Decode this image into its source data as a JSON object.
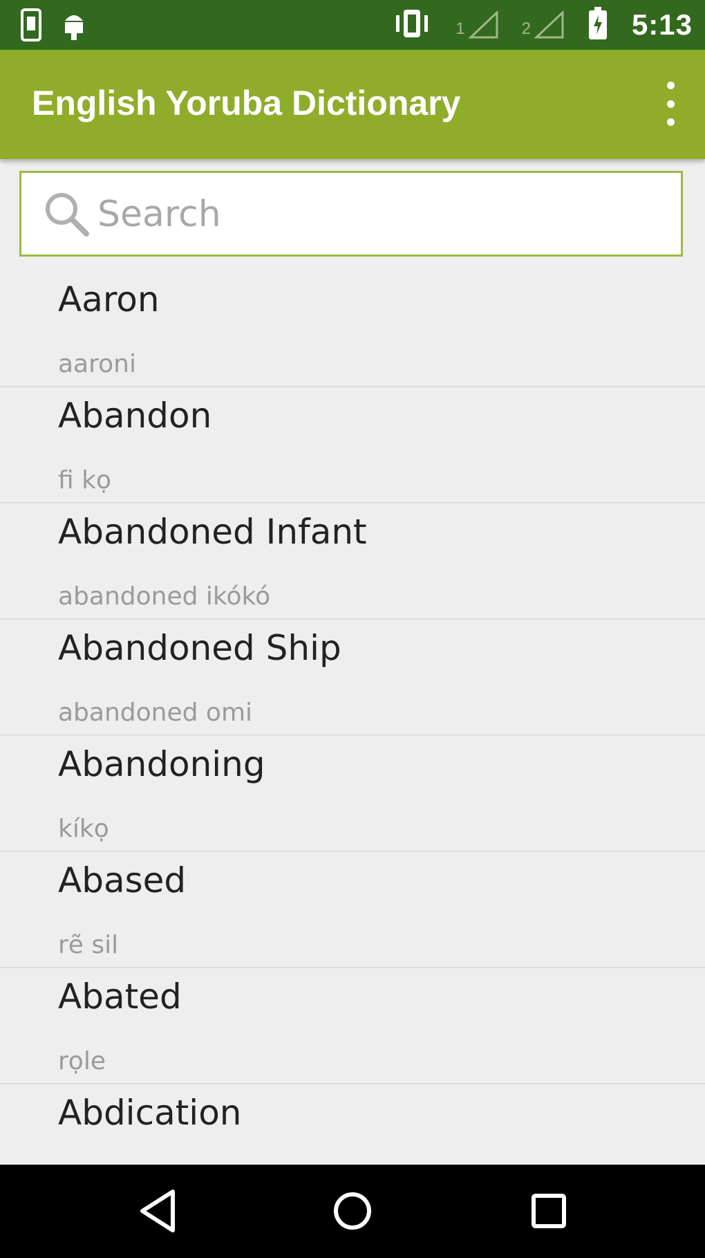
{
  "status_bar": {
    "left_icons": [
      "phone-icon",
      "android-debug-icon"
    ],
    "right_icons": [
      "vibrate-icon",
      "signal-1-icon",
      "signal-2-icon",
      "battery-icon"
    ],
    "sim1_label": "1",
    "sim2_label": "2",
    "time": "5:13"
  },
  "app_bar": {
    "title": "English Yoruba Dictionary",
    "menu_icon": "more-vert-icon"
  },
  "search": {
    "placeholder": "Search",
    "value": "",
    "icon": "search-icon"
  },
  "entries": [
    {
      "word": "Aaron",
      "translation": "aaroni"
    },
    {
      "word": "Abandon",
      "translation": "fi kọ"
    },
    {
      "word": "Abandoned Infant",
      "translation": "abandoned ikókó"
    },
    {
      "word": "Abandoned Ship",
      "translation": "abandoned omi"
    },
    {
      "word": "Abandoning",
      "translation": "kíkọ"
    },
    {
      "word": "Abased",
      "translation": "rẽ sil"
    },
    {
      "word": "Abated",
      "translation": "rọle"
    },
    {
      "word": "Abdication",
      "translation": ""
    }
  ],
  "nav_bar": {
    "icons": [
      "back-icon",
      "home-icon",
      "recents-icon"
    ]
  },
  "colors": {
    "status_bar": "#33691e",
    "app_bar": "#8fad2b",
    "search_border": "#9cbb45",
    "background": "#eeeeee"
  }
}
